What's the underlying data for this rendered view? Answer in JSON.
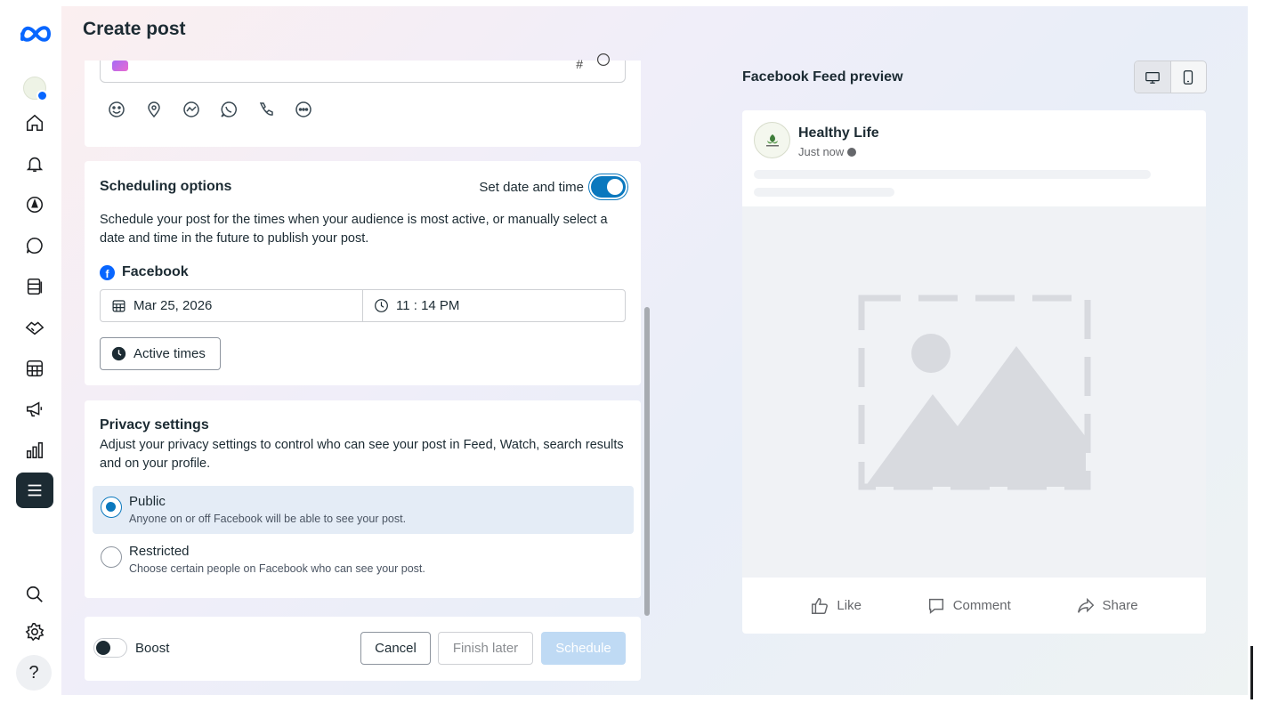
{
  "page": {
    "title": "Create post"
  },
  "sidebar": {
    "items": [
      {
        "name": "home"
      },
      {
        "name": "notifications"
      },
      {
        "name": "planner"
      },
      {
        "name": "inbox"
      },
      {
        "name": "content"
      },
      {
        "name": "partnerships"
      },
      {
        "name": "calendar-table"
      },
      {
        "name": "ads"
      },
      {
        "name": "insights"
      },
      {
        "name": "all-tools"
      }
    ],
    "help_label": "?"
  },
  "composer": {
    "hashtag": "#"
  },
  "scheduling": {
    "title": "Scheduling options",
    "toggle_label": "Set date and time",
    "toggle_on": true,
    "description": "Schedule your post for the times when your audience is most active, or manually select a date and time in the future to publish your post.",
    "platform_label": "Facebook",
    "date": "Mar 25, 2026",
    "time": "11 : 14 PM",
    "active_times_label": "Active times"
  },
  "privacy": {
    "title": "Privacy settings",
    "description": "Adjust your privacy settings to control who can see your post in Feed, Watch, search results and on your profile.",
    "options": [
      {
        "label": "Public",
        "sublabel": "Anyone on or off Facebook will be able to see your post.",
        "selected": true
      },
      {
        "label": "Restricted",
        "sublabel": "Choose certain people on Facebook who can see your post.",
        "selected": false
      }
    ]
  },
  "footer": {
    "boost_label": "Boost",
    "boost_on": false,
    "cancel_label": "Cancel",
    "finish_later_label": "Finish later",
    "schedule_label": "Schedule"
  },
  "preview": {
    "title": "Facebook Feed preview",
    "page_name": "Healthy Life",
    "timestamp": "Just now",
    "actions": {
      "like": "Like",
      "comment": "Comment",
      "share": "Share"
    }
  },
  "colors": {
    "accent": "#0a78be",
    "facebook_blue": "#0866ff",
    "schedule_disabled": "#bfdaf4",
    "sidebar_active": "#1c2b33"
  }
}
